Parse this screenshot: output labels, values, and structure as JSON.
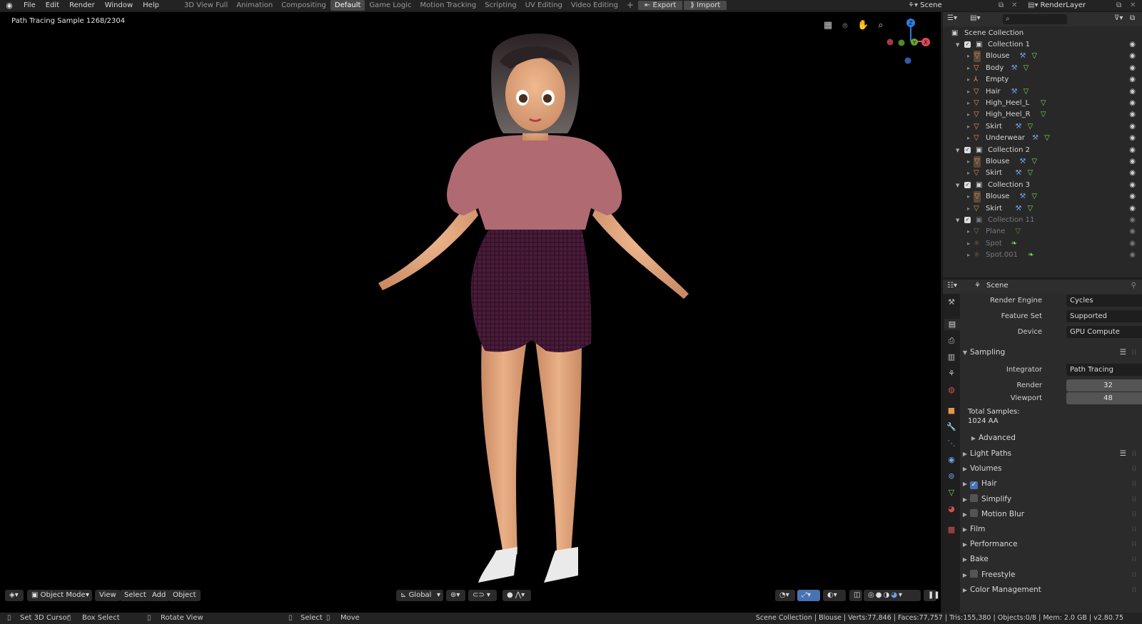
{
  "menu": [
    "File",
    "Edit",
    "Render",
    "Window",
    "Help"
  ],
  "workspaces": [
    {
      "label": "3D View Full",
      "active": false
    },
    {
      "label": "Animation",
      "active": false
    },
    {
      "label": "Compositing",
      "active": false
    },
    {
      "label": "Default",
      "active": true
    },
    {
      "label": "Game Logic",
      "active": false
    },
    {
      "label": "Motion Tracking",
      "active": false
    },
    {
      "label": "Scripting",
      "active": false
    },
    {
      "label": "UV Editing",
      "active": false
    },
    {
      "label": "Video Editing",
      "active": false
    }
  ],
  "add_workspace": "+",
  "export_label": "Export",
  "import_label": "Import",
  "scene_name": "Scene",
  "view_layer": "RenderLayer",
  "viewport": {
    "overlay_text": "Path Tracing Sample 1268/2304",
    "mode": "Object Mode",
    "menus": [
      "View",
      "Select",
      "Add",
      "Object"
    ],
    "orientation": "Global",
    "gizmo": {
      "z": "Z",
      "y": "Y",
      "x": "X"
    }
  },
  "outliner": {
    "root": "Scene Collection",
    "rows": [
      {
        "label": "Collection 1",
        "kind": "collection",
        "indent": 0,
        "expanded": true,
        "dim": false
      },
      {
        "label": "Blouse",
        "kind": "mesh",
        "indent": 1,
        "dim": false,
        "mods": [
          "wrench",
          "tri"
        ],
        "active": true
      },
      {
        "label": "Body",
        "kind": "mesh",
        "indent": 1,
        "dim": false,
        "mods": [
          "wrench",
          "tri"
        ]
      },
      {
        "label": "Empty",
        "kind": "empty",
        "indent": 1,
        "dim": false,
        "mods": []
      },
      {
        "label": "Hair",
        "kind": "mesh",
        "indent": 1,
        "dim": false,
        "mods": [
          "wrench",
          "tri"
        ]
      },
      {
        "label": "High_Heel_L",
        "kind": "mesh",
        "indent": 1,
        "dim": false,
        "mods": [
          "tri"
        ]
      },
      {
        "label": "High_Heel_R",
        "kind": "mesh",
        "indent": 1,
        "dim": false,
        "mods": [
          "tri"
        ]
      },
      {
        "label": "Skirt",
        "kind": "mesh",
        "indent": 1,
        "dim": false,
        "mods": [
          "wrench",
          "tri"
        ]
      },
      {
        "label": "Underwear",
        "kind": "mesh",
        "indent": 1,
        "dim": false,
        "mods": [
          "wrench",
          "tri"
        ]
      },
      {
        "label": "Collection 2",
        "kind": "collection",
        "indent": 0,
        "expanded": true,
        "dim": false
      },
      {
        "label": "Blouse",
        "kind": "mesh",
        "indent": 1,
        "dim": false,
        "mods": [
          "wrench",
          "tri"
        ],
        "active": true
      },
      {
        "label": "Skirt",
        "kind": "mesh",
        "indent": 1,
        "dim": false,
        "mods": [
          "wrench",
          "tri"
        ]
      },
      {
        "label": "Collection 3",
        "kind": "collection",
        "indent": 0,
        "expanded": true,
        "dim": false
      },
      {
        "label": "Blouse",
        "kind": "mesh",
        "indent": 1,
        "dim": false,
        "mods": [
          "wrench",
          "tri"
        ],
        "active": true
      },
      {
        "label": "Skirt",
        "kind": "mesh",
        "indent": 1,
        "dim": false,
        "mods": [
          "wrench",
          "tri"
        ]
      },
      {
        "label": "Collection 11",
        "kind": "collection",
        "indent": 0,
        "expanded": true,
        "dim": true
      },
      {
        "label": "Plane",
        "kind": "mesh",
        "indent": 1,
        "dim": true,
        "mods": [
          "tri"
        ]
      },
      {
        "label": "Spot",
        "kind": "light",
        "indent": 1,
        "dim": true,
        "mods": [
          "leaf"
        ]
      },
      {
        "label": "Spot.001",
        "kind": "light",
        "indent": 1,
        "dim": true,
        "mods": [
          "leaf"
        ]
      }
    ]
  },
  "properties": {
    "context": "Scene",
    "render_engine_label": "Render Engine",
    "render_engine": "Cycles",
    "feature_set_label": "Feature Set",
    "feature_set": "Supported",
    "device_label": "Device",
    "device": "GPU Compute",
    "sampling_label": "Sampling",
    "integrator_label": "Integrator",
    "integrator": "Path Tracing",
    "render_label": "Render",
    "render_samples": "32",
    "viewport_label": "Viewport",
    "viewport_samples": "48",
    "total_samples_label": "Total Samples:",
    "total_samples": "1024 AA",
    "advanced_label": "Advanced",
    "panels": [
      {
        "label": "Light Paths",
        "check": null,
        "list": true
      },
      {
        "label": "Volumes",
        "check": null,
        "list": false
      },
      {
        "label": "Hair",
        "check": true,
        "list": false
      },
      {
        "label": "Simplify",
        "check": false,
        "list": false
      },
      {
        "label": "Motion Blur",
        "check": false,
        "list": false
      },
      {
        "label": "Film",
        "check": null,
        "list": false
      },
      {
        "label": "Performance",
        "check": null,
        "list": false
      },
      {
        "label": "Bake",
        "check": null,
        "list": false
      },
      {
        "label": "Freestyle",
        "check": false,
        "list": false
      },
      {
        "label": "Color Management",
        "check": null,
        "list": false
      }
    ]
  },
  "status": {
    "set_cursor": "Set 3D Cursor",
    "box_select": "Box Select",
    "rotate_view": "Rotate View",
    "select": "Select",
    "move": "Move",
    "stats": "Scene Collection | Blouse | Verts:77,846 | Faces:77,757 | Tris:155,380 | Objects:0/8 | Mem: 2.0 GB | v2.80.75"
  },
  "colors": {
    "accent": "#4772b3",
    "header": "#232323",
    "object_orange": "#e8954a",
    "mesh_green": "#7ed957",
    "modifier_blue": "#6fa3e8"
  }
}
